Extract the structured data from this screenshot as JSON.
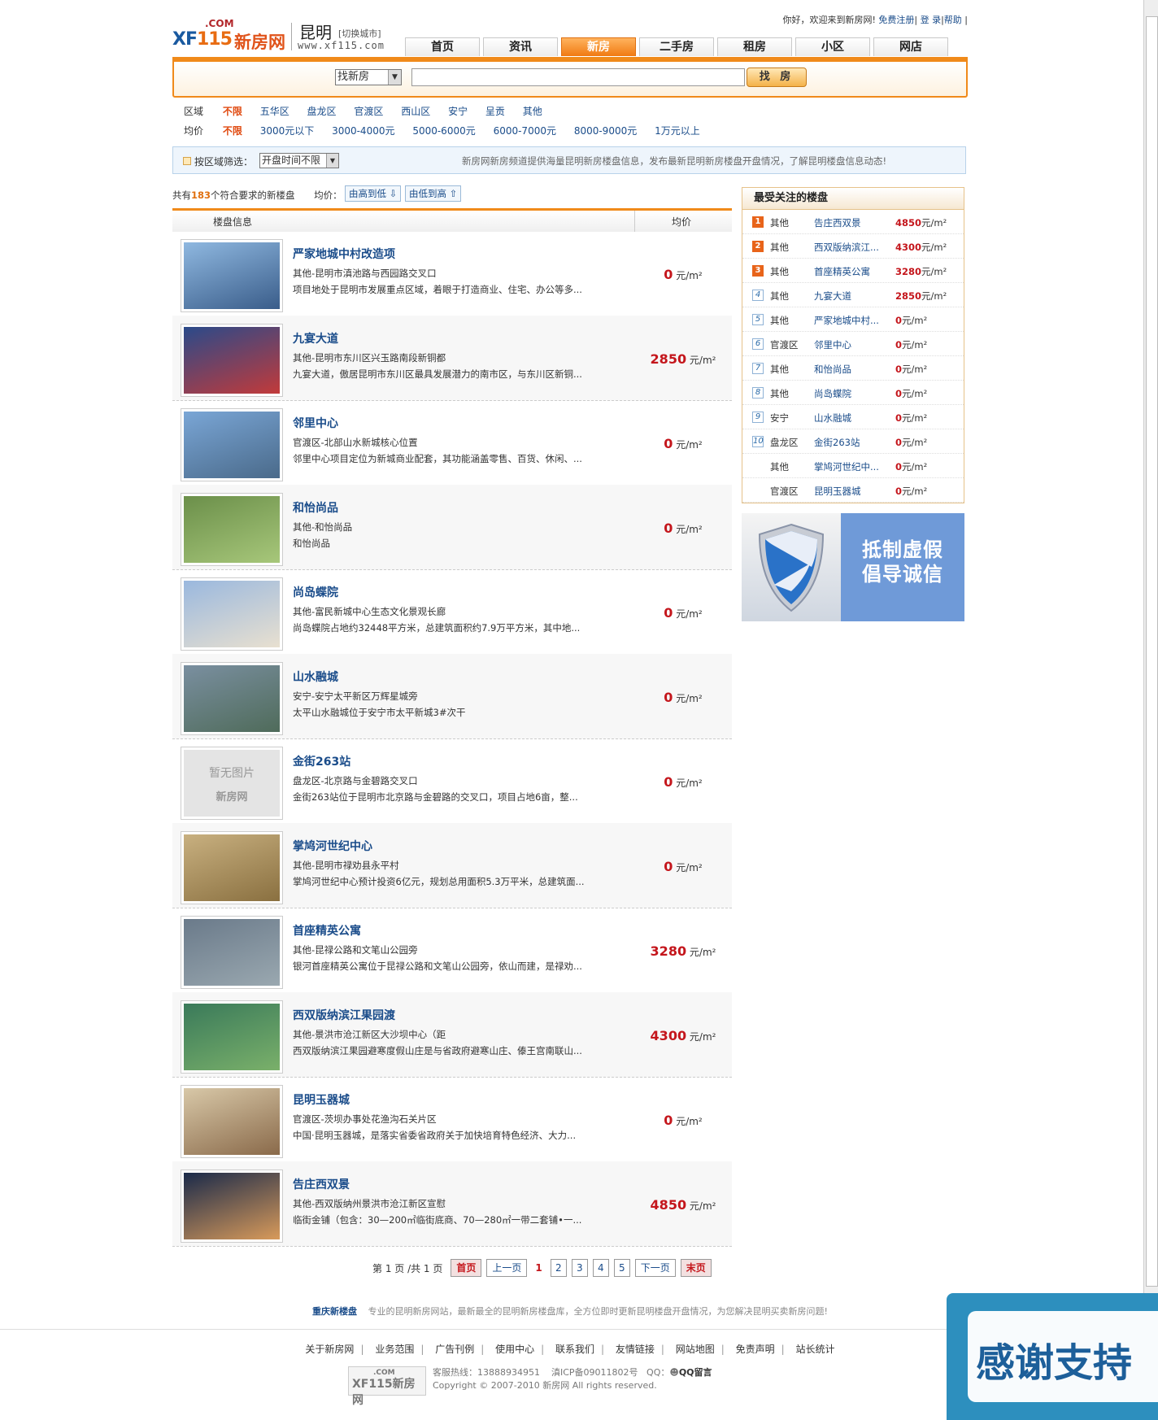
{
  "header": {
    "logo_com": ".COM",
    "logo_xf": "XF",
    "logo_num": "115",
    "logo_cn": "新房网",
    "city": "昆明",
    "switch_city": "[切换城市]",
    "site_url": "www.xf115.com",
    "greeting": "你好，欢迎来到新房网!",
    "register": "免费注册",
    "login": "登 录",
    "help": "帮助"
  },
  "nav": {
    "items": [
      "首页",
      "资讯",
      "新房",
      "二手房",
      "租房",
      "小区",
      "网店"
    ],
    "active": "新房"
  },
  "search": {
    "type_value": "找新房",
    "input_value": "",
    "button": "找 房"
  },
  "filters": {
    "region_label": "区域",
    "region_options": [
      "不限",
      "五华区",
      "盘龙区",
      "官渡区",
      "西山区",
      "安宁",
      "呈贡",
      "其他"
    ],
    "price_label": "均价",
    "price_options": [
      "不限",
      "3000元以下",
      "3000-4000元",
      "5000-6000元",
      "6000-7000元",
      "8000-9000元",
      "1万元以上"
    ]
  },
  "sortbar": {
    "label": "按区域筛选：",
    "select_value": "开盘时间不限",
    "note": "新房网新房频道提供海量昆明新房楼盘信息，发布最新昆明新房楼盘开盘情况，了解昆明楼盘信息动态!"
  },
  "list": {
    "count_prefix": "共有",
    "count": "183",
    "count_suffix": "个符合要求的新楼盘",
    "price_sort_label": "均价：",
    "sort_desc": "由高到低 ⇩",
    "sort_asc": "由低到高 ⇧",
    "col_info": "楼盘信息",
    "col_price": "均价",
    "unit": "元/m²",
    "items": [
      {
        "name": "严家地城中村改造项",
        "addr": "其他-昆明市滇池路与西园路交叉口",
        "desc": "项目地处于昆明市发展重点区域，着眼于打造商业、住宅、办公等多...",
        "price": "0"
      },
      {
        "name": "九宴大道",
        "addr": "其他-昆明市东川区兴玉路南段新铜都",
        "desc": "九宴大道，傲居昆明市东川区最具发展潜力的南市区，与东川区新铜...",
        "price": "2850"
      },
      {
        "name": "邻里中心",
        "addr": "官渡区-北部山水新城核心位置",
        "desc": "邻里中心项目定位为新城商业配套，其功能涵盖零售、百货、休闲、...",
        "price": "0"
      },
      {
        "name": "和怡尚品",
        "addr": "其他-和怡尚品",
        "desc": "和怡尚品",
        "price": "0"
      },
      {
        "name": "尚岛蝶院",
        "addr": "其他-富民新城中心生态文化景观长廊",
        "desc": "尚岛蝶院占地约32448平方米，总建筑面积约7.9万平方米，其中地...",
        "price": "0"
      },
      {
        "name": "山水融城",
        "addr": "安宁-安宁太平新区万辉星城旁",
        "desc": "太平山水融城位于安宁市太平新城3#次干",
        "price": "0"
      },
      {
        "name": "金街263站",
        "addr": "盘龙区-北京路与金碧路交叉口",
        "desc": "金街263站位于昆明市北京路与金碧路的交叉口，项目占地6亩，整...",
        "price": "0"
      },
      {
        "name": "掌鸠河世纪中心",
        "addr": "其他-昆明市禄劝县永平村",
        "desc": "掌鸠河世纪中心预计投资6亿元，规划总用面积5.3万平米，总建筑面...",
        "price": "0"
      },
      {
        "name": "首座精英公寓",
        "addr": "其他-昆禄公路和文笔山公园旁",
        "desc": "银河首座精英公寓位于昆禄公路和文笔山公园旁，依山而建，是禄劝...",
        "price": "3280"
      },
      {
        "name": "西双版纳滨江果园渡",
        "addr": "其他-景洪市沧江新区大沙坝中心（距",
        "desc": "西双版纳滨江果园避寒度假山庄是与省政府避寒山庄、傣王宫南联山...",
        "price": "4300"
      },
      {
        "name": "昆明玉器城",
        "addr": "官渡区-茨坝办事处花渔沟石关片区",
        "desc": "中国·昆明玉器城，是落实省委省政府关于加快培育特色经济、大力...",
        "price": "0"
      },
      {
        "name": "告庄西双景",
        "addr": "其他-西双版纳州景洪市沧江新区宣慰",
        "desc": "临街金铺（包含：30—200㎡临街底商、70—280㎡一带二套铺•一...",
        "price": "4850"
      }
    ],
    "no_image_text": "暂无图片"
  },
  "pager": {
    "page_text": "第 1 页 /共 1 页",
    "first": "首页",
    "prev": "上一页",
    "current": "1",
    "pages": [
      "2",
      "3",
      "4",
      "5"
    ],
    "next": "下一页",
    "last": "末页"
  },
  "sidebar": {
    "title": "最受关注的楼盘",
    "unit": "元/m²",
    "items": [
      {
        "rank": "1",
        "area": "其他",
        "name": "告庄西双景",
        "price": "4850"
      },
      {
        "rank": "2",
        "area": "其他",
        "name": "西双版纳滨江...",
        "price": "4300"
      },
      {
        "rank": "3",
        "area": "其他",
        "name": "首座精英公寓",
        "price": "3280"
      },
      {
        "rank": "4",
        "area": "其他",
        "name": "九宴大道",
        "price": "2850"
      },
      {
        "rank": "5",
        "area": "其他",
        "name": "严家地城中村...",
        "price": "0"
      },
      {
        "rank": "6",
        "area": "官渡区",
        "name": "邻里中心",
        "price": "0"
      },
      {
        "rank": "7",
        "area": "其他",
        "name": "和怡尚品",
        "price": "0"
      },
      {
        "rank": "8",
        "area": "其他",
        "name": "尚岛蝶院",
        "price": "0"
      },
      {
        "rank": "9",
        "area": "安宁",
        "name": "山水融城",
        "price": "0"
      },
      {
        "rank": "10",
        "area": "盘龙区",
        "name": "金街263站",
        "price": "0"
      },
      {
        "rank": "",
        "area": "其他",
        "name": "掌鸠河世纪中...",
        "price": "0"
      },
      {
        "rank": "",
        "area": "官渡区",
        "name": "昆明玉器城",
        "price": "0"
      }
    ],
    "banner_line1": "抵制虚假",
    "banner_line2": "倡导诚信"
  },
  "footer": {
    "promo_link": "重庆新楼盘",
    "promo_text": "专业的昆明新房网站，最新最全的昆明新房楼盘库，全方位即时更新昆明楼盘开盘情况，为您解决昆明买卖新房问题!",
    "links": [
      "关于新房网",
      "业务范围",
      "广告刊例",
      "使用中心",
      "联系我们",
      "友情链接",
      "网站地图",
      "免责声明",
      "站长统计"
    ],
    "hotline": "客服热线：13888934951",
    "icp": "滇ICP备09011802号",
    "qq": "QQ：",
    "qq_msg": "QQ留言",
    "copyright": "Copyright © 2007-2010  新房网  All rights reserved."
  },
  "floating": {
    "thanks_text": "感谢支持"
  }
}
